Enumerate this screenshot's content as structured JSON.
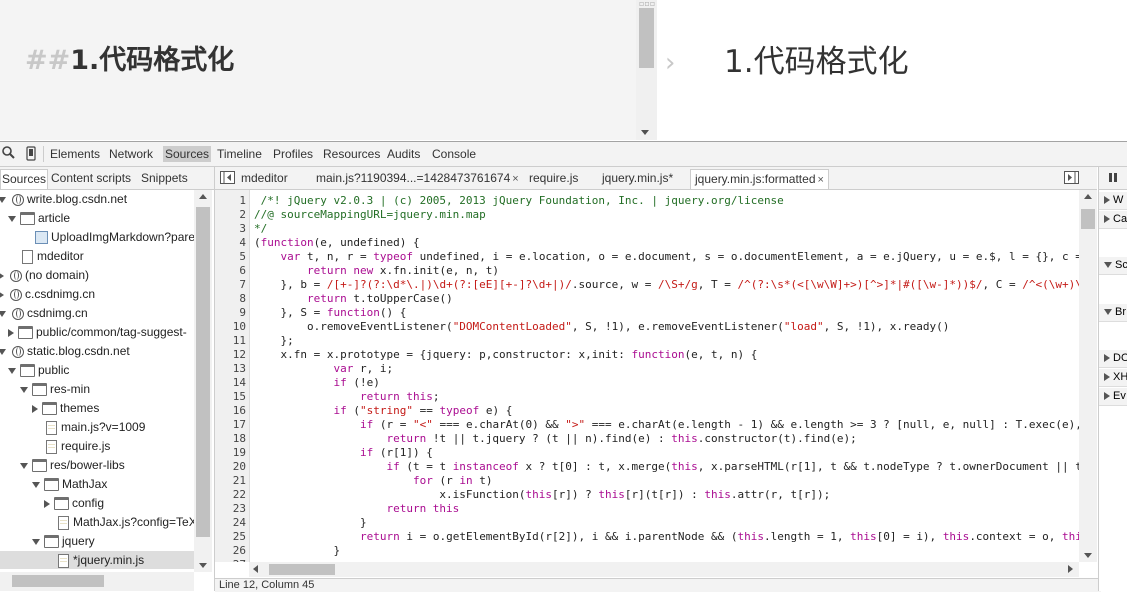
{
  "md_editor": {
    "hash": "##",
    "source_heading": "1.代码格式化",
    "preview_heading": "1.代码格式化"
  },
  "devtools": {
    "panels": [
      "Elements",
      "Network",
      "Sources",
      "Timeline",
      "Profiles",
      "Resources",
      "Audits",
      "Console"
    ],
    "active_panel": "Sources",
    "navigator_tabs": [
      "Sources",
      "Content scripts",
      "Snippets"
    ],
    "tree": [
      {
        "label": "write.blog.csdn.net",
        "type": "domain",
        "expanded": true
      },
      {
        "label": "article",
        "type": "folder",
        "expanded": true
      },
      {
        "label": "UploadImgMarkdown?parentId",
        "type": "file-img"
      },
      {
        "label": "mdeditor",
        "type": "file"
      },
      {
        "label": "(no domain)",
        "type": "domain",
        "expanded": false
      },
      {
        "label": "c.csdnimg.cn",
        "type": "domain",
        "expanded": false
      },
      {
        "label": "csdnimg.cn",
        "type": "domain",
        "expanded": true
      },
      {
        "label": "public/common/tag-suggest-",
        "type": "folder",
        "expanded": false
      },
      {
        "label": "static.blog.csdn.net",
        "type": "domain",
        "expanded": true
      },
      {
        "label": "public",
        "type": "folder",
        "expanded": true
      },
      {
        "label": "res-min",
        "type": "folder",
        "expanded": true
      },
      {
        "label": "themes",
        "type": "folder",
        "expanded": false
      },
      {
        "label": "main.js?v=1009",
        "type": "file-js"
      },
      {
        "label": "require.js",
        "type": "file-js"
      },
      {
        "label": "res/bower-libs",
        "type": "folder",
        "expanded": true
      },
      {
        "label": "MathJax",
        "type": "folder",
        "expanded": true
      },
      {
        "label": "config",
        "type": "folder",
        "expanded": false
      },
      {
        "label": "MathJax.js?config=TeX-",
        "type": "file-js"
      },
      {
        "label": "jquery",
        "type": "folder",
        "expanded": true
      },
      {
        "label": "*jquery.min.js",
        "type": "file-js",
        "selected": true
      }
    ],
    "file_tabs": [
      {
        "label": "mdeditor",
        "closable": false
      },
      {
        "label": "main.js?1190394...=1428473761674",
        "closable": true
      },
      {
        "label": "require.js",
        "closable": false
      },
      {
        "label": "jquery.min.js*",
        "closable": false
      },
      {
        "label": "jquery.min.js:formatted",
        "closable": true,
        "active": true
      }
    ],
    "close_glyph": "×",
    "code_lines": [
      "1",
      "2",
      "3",
      "4",
      "5",
      "6",
      "7",
      "8",
      "9",
      "10",
      "11",
      "12",
      "13",
      "14",
      "15",
      "16",
      "17",
      "18",
      "19",
      "20",
      "21",
      "22",
      "23",
      "24",
      "25",
      "26",
      "27"
    ],
    "status_text": "Line 12, Column 45",
    "side_sections": [
      "W",
      "Ca",
      "Sc",
      "Br",
      "DO",
      "XH",
      "Ev"
    ]
  },
  "colors": {
    "keyword": "#aa0d91",
    "string": "#c41a16",
    "comment": "#236e25",
    "toolbar_bg": "#f3f3f3",
    "selection": "#dddddd"
  }
}
